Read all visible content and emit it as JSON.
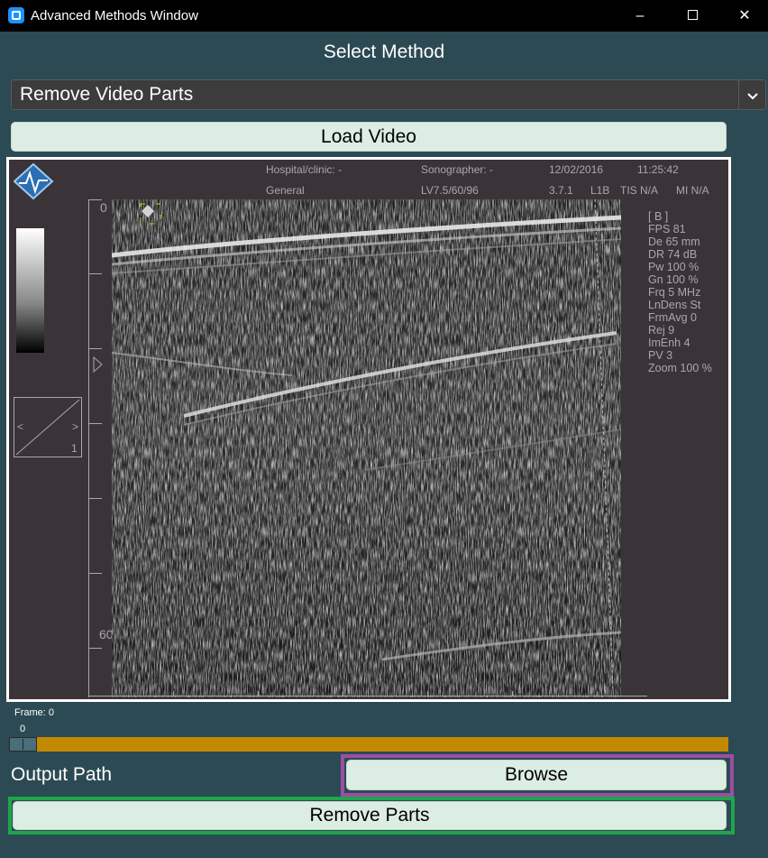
{
  "window": {
    "title": "Advanced Methods Window",
    "minimize": "–",
    "close": "✕"
  },
  "method": {
    "label": "Select Method",
    "selected": "Remove Video Parts",
    "dropdown_icon": "chevron-down-icon"
  },
  "load_button": "Load Video",
  "video": {
    "header": {
      "hospital": "Hospital/clinic: -",
      "sonographer": "Sonographer: -",
      "date": "12/02/2016",
      "time": "11:25:42",
      "preset": "General",
      "probe": "LV7.5/60/96",
      "version": "3.7.1",
      "mode": "L1B",
      "tis": "TIS N/A",
      "mi": "MI N/A"
    },
    "zoom_left": "<",
    "zoom_right": ">",
    "zoom_value": "1",
    "ruler": {
      "top": "0",
      "bottom": "60"
    },
    "params": [
      "[ B ]",
      "FPS 81",
      "De 65 mm",
      "DR 74 dB",
      "Pw 100 %",
      "Gn 100 %",
      "Frq 5 MHz",
      "LnDens St",
      "FrmAvg 0",
      "Rej 9",
      "ImEnh 4",
      "PV 3",
      "Zoom 100 %"
    ]
  },
  "frame": {
    "label": "Frame: 0",
    "value": "0",
    "fraction": 0
  },
  "output_path_label": "Output Path",
  "browse_button": "Browse",
  "remove_button": "Remove Parts",
  "colors": {
    "background": "#2c4a53",
    "slider": "#c28a00",
    "browse_highlight": "#9b4fa3",
    "remove_highlight": "#1fa54b",
    "button": "#dcede3"
  }
}
